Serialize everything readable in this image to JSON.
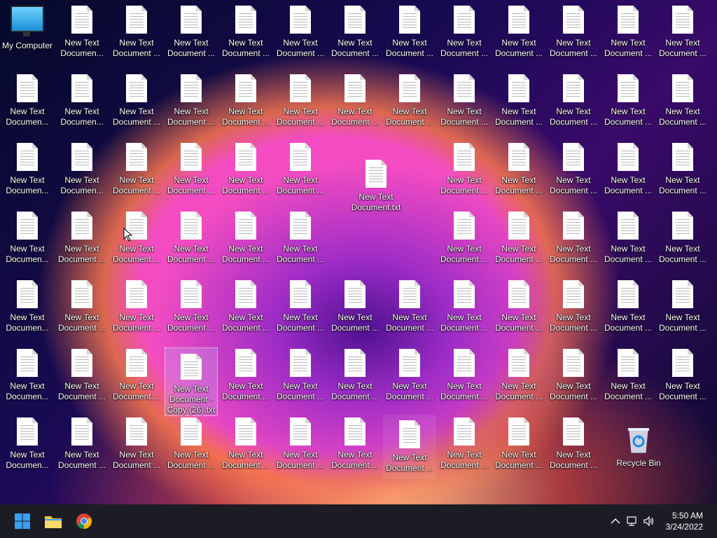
{
  "desktop": {
    "my_computer_label": "My Computer",
    "recycle_bin_label": "Recycle Bin",
    "moved_file_label": "New Text Document.txt",
    "selected_file_label": "New Text Document - Copy (26).txt",
    "file_label_short": "New Text Documen...",
    "file_label": "New Text Document ..."
  },
  "taskbar": {
    "clock_time": "5:50 AM",
    "clock_date": "3/24/2022",
    "start_icon": "windows-start-icon",
    "explorer_icon": "file-explorer-icon",
    "chrome_icon": "chrome-icon"
  }
}
